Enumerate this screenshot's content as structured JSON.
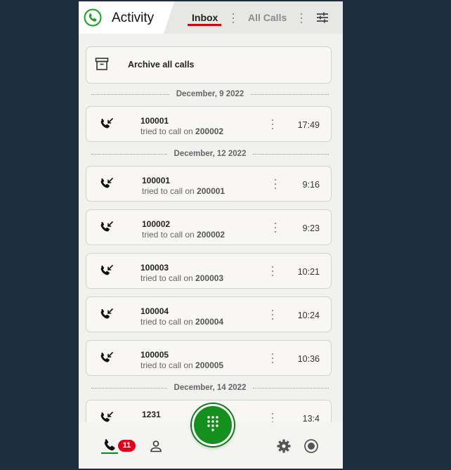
{
  "header": {
    "title": "Activity",
    "tabs": [
      {
        "label": "Inbox",
        "active": true
      },
      {
        "label": "All Calls",
        "active": false
      }
    ]
  },
  "archive": {
    "label": "Archive all calls"
  },
  "groups": [
    {
      "date": "December, 9 2022",
      "calls": [
        {
          "caller": "100001",
          "prefix": "tried to call on ",
          "target": "200002",
          "time": "17:49"
        }
      ]
    },
    {
      "date": "December, 12 2022",
      "calls": [
        {
          "caller": "100001",
          "prefix": "tried to call on ",
          "target": "200001",
          "time": "9:16"
        },
        {
          "caller": "100002",
          "prefix": "tried to call on ",
          "target": "200002",
          "time": "9:23"
        },
        {
          "caller": "100003",
          "prefix": "tried to call on ",
          "target": "200003",
          "time": "10:21"
        },
        {
          "caller": "100004",
          "prefix": "tried to call on ",
          "target": "200004",
          "time": "10:24"
        },
        {
          "caller": "100005",
          "prefix": "tried to call on ",
          "target": "200005",
          "time": "10:36"
        }
      ]
    },
    {
      "date": "December, 14 2022",
      "calls": [
        {
          "caller": "1231",
          "prefix": "",
          "target": "",
          "time": "13:4"
        }
      ]
    }
  ],
  "bottom_nav": {
    "badge_count": "11",
    "items": [
      "phone-icon",
      "contacts-icon",
      "dialpad-icon",
      "settings-icon",
      "record-icon"
    ]
  },
  "colors": {
    "accent_green": "#15901f",
    "active_tab_underline": "#d8000f",
    "badge_red": "#e0001b",
    "page_background": "#1f2d40"
  }
}
